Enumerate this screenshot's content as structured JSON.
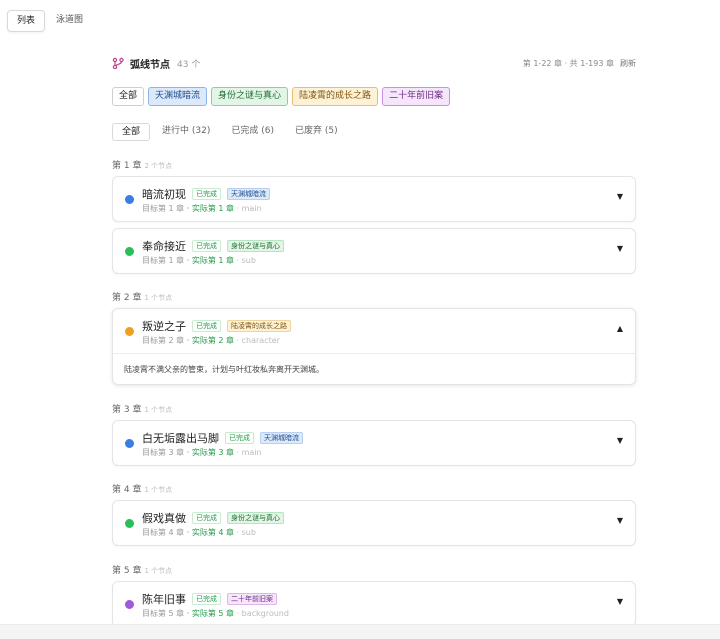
{
  "view_tabs": {
    "list": "列表",
    "swimlane": "泳道图"
  },
  "header": {
    "title": "弧线节点",
    "count": "43 个",
    "range": "第 1-22 章 · 共 1-193 章",
    "refresh": "刷新"
  },
  "arcs": {
    "all": "全部",
    "items": [
      "天渊城暗流",
      "身份之谜与真心",
      "陆凌霄的成长之路",
      "二十年前旧案"
    ]
  },
  "status_tabs": [
    "全部",
    "进行中 (32)",
    "已完成 (6)",
    "已废弃 (5)"
  ],
  "chapters": [
    {
      "label": "第 1 章",
      "count": "2 个节点"
    },
    {
      "label": "第 2 章",
      "count": "1 个节点"
    },
    {
      "label": "第 3 章",
      "count": "1 个节点"
    },
    {
      "label": "第 4 章",
      "count": "1 个节点"
    },
    {
      "label": "第 5 章",
      "count": "1 个节点"
    }
  ],
  "nodes": [
    {
      "title": "暗流初现",
      "status": "已完成",
      "arc": "天渊城暗流",
      "target": "目标第 1 章",
      "actual": "· 实际第 1 章",
      "kind": "· main",
      "chevron": "▼",
      "color": "#3b7de0"
    },
    {
      "title": "奉命接近",
      "status": "已完成",
      "arc": "身份之谜与真心",
      "target": "目标第 1 章",
      "actual": "· 实际第 1 章",
      "kind": "· sub",
      "chevron": "▼",
      "color": "#2bbf5a"
    },
    {
      "title": "叛逆之子",
      "status": "已完成",
      "arc": "陆凌霄的成长之路",
      "target": "目标第 2 章",
      "actual": "· 实际第 2 章",
      "kind": "· character",
      "chevron": "▲",
      "color": "#f0a020",
      "description": "陆凌霄不满父亲的管束，计划与叶红妆私奔离开天渊城。"
    },
    {
      "title": "白无垢露出马脚",
      "status": "已完成",
      "arc": "天渊城暗流",
      "target": "目标第 3 章",
      "actual": "· 实际第 3 章",
      "kind": "· main",
      "chevron": "▼",
      "color": "#3b7de0"
    },
    {
      "title": "假戏真做",
      "status": "已完成",
      "arc": "身份之谜与真心",
      "target": "目标第 4 章",
      "actual": "· 实际第 4 章",
      "kind": "· sub",
      "chevron": "▼",
      "color": "#2bbf5a"
    },
    {
      "title": "陈年旧事",
      "status": "已完成",
      "arc": "二十年前旧案",
      "target": "目标第 5 章",
      "actual": "· 实际第 5 章",
      "kind": "· background",
      "chevron": "▼",
      "color": "#a259d9"
    }
  ]
}
